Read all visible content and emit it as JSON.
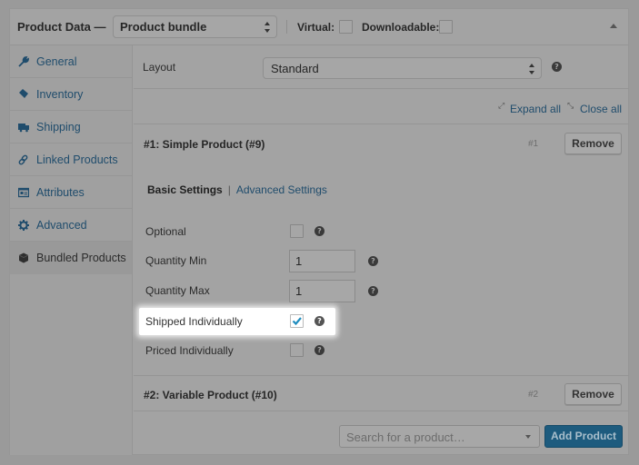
{
  "header": {
    "title": "Product Data —",
    "product_type": "Product bundle",
    "virtual_label": "Virtual:",
    "virtual_checked": false,
    "downloadable_label": "Downloadable:",
    "downloadable_checked": false,
    "collapse_icon": "triangle-up-icon"
  },
  "sidebar": {
    "items": [
      {
        "label": "General",
        "icon": "wrench-icon",
        "active": false
      },
      {
        "label": "Inventory",
        "icon": "tag-icon",
        "active": false
      },
      {
        "label": "Shipping",
        "icon": "truck-icon",
        "active": false
      },
      {
        "label": "Linked Products",
        "icon": "link-icon",
        "active": false
      },
      {
        "label": "Attributes",
        "icon": "list-card-icon",
        "active": false
      },
      {
        "label": "Advanced",
        "icon": "gear-icon",
        "active": false
      },
      {
        "label": "Bundled Products",
        "icon": "box-icon",
        "active": true
      }
    ]
  },
  "main": {
    "layout_label": "Layout",
    "layout_value": "Standard",
    "expand_all": "Expand all",
    "close_all": "Close all",
    "bundled_items": [
      {
        "title": "#1: Simple Product (#9)",
        "number": "#1",
        "remove_label": "Remove",
        "tabs": {
          "basic": "Basic Settings",
          "separator": "|",
          "advanced": "Advanced Settings"
        },
        "fields": {
          "optional": {
            "label": "Optional",
            "checked": false
          },
          "quantity_min": {
            "label": "Quantity Min",
            "value": "1"
          },
          "quantity_max": {
            "label": "Quantity Max",
            "value": "1"
          },
          "shipped_individually": {
            "label": "Shipped Individually",
            "checked": true
          },
          "priced_individually": {
            "label": "Priced Individually",
            "checked": false
          }
        }
      },
      {
        "title": "#2: Variable Product (#10)",
        "number": "#2",
        "remove_label": "Remove"
      }
    ],
    "search_placeholder": "Search for a product…",
    "add_product_label": "Add Product"
  },
  "colors": {
    "link": "#1f4c6c",
    "primary_button": "#1d5b7e",
    "checkmark": "#1e8cbe"
  }
}
